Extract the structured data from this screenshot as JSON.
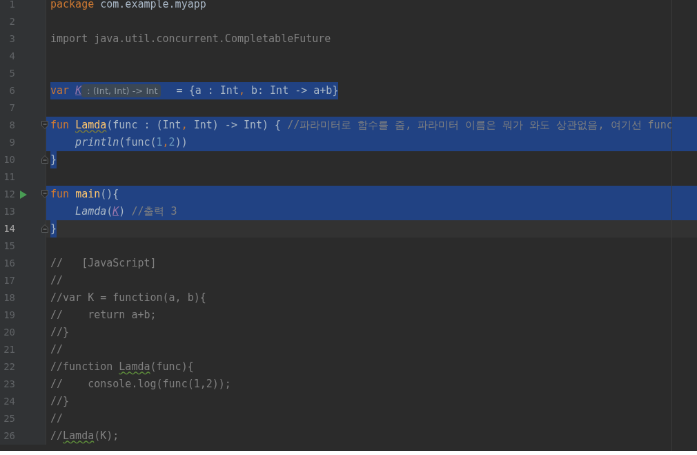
{
  "lines": [
    {
      "number": "1",
      "selected": false,
      "current": false,
      "run": false,
      "fold_start": false,
      "fold_end": false,
      "tokens": [
        {
          "text": "package ",
          "kind": "keyword"
        },
        {
          "text": "com.example.myapp",
          "kind": "plain"
        }
      ]
    },
    {
      "number": "2",
      "selected": false,
      "current": false,
      "run": false,
      "fold_start": false,
      "fold_end": false
    },
    {
      "number": "3",
      "selected": false,
      "current": false,
      "run": false,
      "fold_start": false,
      "fold_end": false,
      "tokens": [
        {
          "text": "import java.util.concurrent.CompletableFuture",
          "kind": "unused"
        }
      ]
    },
    {
      "number": "4",
      "selected": false,
      "current": false,
      "run": false,
      "fold_start": false,
      "fold_end": false
    },
    {
      "number": "5",
      "selected": false,
      "current": false,
      "run": false,
      "fold_start": false,
      "fold_end": false
    },
    {
      "number": "6",
      "selected": true,
      "current": false,
      "run": false,
      "fold_start": false,
      "fold_end": false,
      "tokens": [
        {
          "text": "var ",
          "kind": "keyword"
        },
        {
          "text": "K",
          "kind": "ref"
        },
        {
          "text": " : (Int, Int) -> Int",
          "kind": "hint"
        },
        {
          "text": " = {a : Int",
          "kind": "plain"
        },
        {
          "text": ",",
          "kind": "keyword"
        },
        {
          "text": " b: Int -> a+b}",
          "kind": "plain"
        }
      ]
    },
    {
      "number": "7",
      "selected": false,
      "current": false,
      "run": false,
      "fold_start": false,
      "fold_end": false
    },
    {
      "number": "8",
      "selected": true,
      "current": false,
      "run": false,
      "fold_start": true,
      "fold_end": false,
      "tokens": [
        {
          "text": "fun ",
          "kind": "keyword"
        },
        {
          "text": "Lamda",
          "kind": "decl"
        },
        {
          "text": "(func : (Int",
          "kind": "plain"
        },
        {
          "text": ",",
          "kind": "keyword"
        },
        {
          "text": " Int) -> Int) { ",
          "kind": "plain"
        },
        {
          "text": "//파라미터로 함수를 줌, 파라미터 이름은 뭐가 와도 상관없음, 여기선 func",
          "kind": "comment"
        }
      ]
    },
    {
      "number": "9",
      "selected": true,
      "current": false,
      "run": false,
      "fold_start": false,
      "fold_end": false,
      "tokens": [
        {
          "text": "    println",
          "kind": "call"
        },
        {
          "text": "(func(",
          "kind": "plain"
        },
        {
          "text": "1",
          "kind": "number"
        },
        {
          "text": ",",
          "kind": "keyword"
        },
        {
          "text": "2",
          "kind": "number"
        },
        {
          "text": "))",
          "kind": "plain"
        }
      ]
    },
    {
      "number": "10",
      "selected": true,
      "current": false,
      "run": false,
      "fold_start": false,
      "fold_end": true,
      "tokens": [
        {
          "text": "}",
          "kind": "plain"
        }
      ]
    },
    {
      "number": "11",
      "selected": false,
      "current": false,
      "run": false,
      "fold_start": false,
      "fold_end": false
    },
    {
      "number": "12",
      "selected": true,
      "current": false,
      "run": true,
      "fold_start": true,
      "fold_end": false,
      "tokens": [
        {
          "text": "fun ",
          "kind": "keyword"
        },
        {
          "text": "main",
          "kind": "decl"
        },
        {
          "text": "(){",
          "kind": "plain"
        }
      ]
    },
    {
      "number": "13",
      "selected": true,
      "current": false,
      "run": false,
      "fold_start": false,
      "fold_end": false,
      "tokens": [
        {
          "text": "    Lamda",
          "kind": "call"
        },
        {
          "text": "(",
          "kind": "plain"
        },
        {
          "text": "K",
          "kind": "ref"
        },
        {
          "text": ") ",
          "kind": "plain"
        },
        {
          "text": "//출력 3",
          "kind": "comment"
        }
      ]
    },
    {
      "number": "14",
      "selected": true,
      "current": true,
      "run": false,
      "fold_start": false,
      "fold_end": true,
      "tokens": [
        {
          "text": "}",
          "kind": "plain"
        }
      ]
    },
    {
      "number": "15",
      "selected": false,
      "current": false,
      "run": false,
      "fold_start": false,
      "fold_end": false
    },
    {
      "number": "16",
      "selected": false,
      "current": false,
      "run": false,
      "fold_start": false,
      "fold_end": false,
      "tokens": [
        {
          "text": "//   [JavaScript]",
          "kind": "comment"
        }
      ]
    },
    {
      "number": "17",
      "selected": false,
      "current": false,
      "run": false,
      "fold_start": false,
      "fold_end": false,
      "tokens": [
        {
          "text": "//",
          "kind": "comment"
        }
      ]
    },
    {
      "number": "18",
      "selected": false,
      "current": false,
      "run": false,
      "fold_start": false,
      "fold_end": false,
      "tokens": [
        {
          "text": "//var K = function(a, b){",
          "kind": "comment"
        }
      ]
    },
    {
      "number": "19",
      "selected": false,
      "current": false,
      "run": false,
      "fold_start": false,
      "fold_end": false,
      "tokens": [
        {
          "text": "//    return a+b;",
          "kind": "comment"
        }
      ]
    },
    {
      "number": "20",
      "selected": false,
      "current": false,
      "run": false,
      "fold_start": false,
      "fold_end": false,
      "tokens": [
        {
          "text": "//}",
          "kind": "comment"
        }
      ]
    },
    {
      "number": "21",
      "selected": false,
      "current": false,
      "run": false,
      "fold_start": false,
      "fold_end": false,
      "tokens": [
        {
          "text": "//",
          "kind": "comment"
        }
      ]
    },
    {
      "number": "22",
      "selected": false,
      "current": false,
      "run": false,
      "fold_start": false,
      "fold_end": false,
      "tokens": [
        {
          "text": "//function ",
          "kind": "comment"
        },
        {
          "text": "Lamda",
          "kind": "typo"
        },
        {
          "text": "(func){",
          "kind": "comment"
        }
      ]
    },
    {
      "number": "23",
      "selected": false,
      "current": false,
      "run": false,
      "fold_start": false,
      "fold_end": false,
      "tokens": [
        {
          "text": "//    console.log(func(1,2));",
          "kind": "comment"
        }
      ]
    },
    {
      "number": "24",
      "selected": false,
      "current": false,
      "run": false,
      "fold_start": false,
      "fold_end": false,
      "tokens": [
        {
          "text": "//}",
          "kind": "comment"
        }
      ]
    },
    {
      "number": "25",
      "selected": false,
      "current": false,
      "run": false,
      "fold_start": false,
      "fold_end": false,
      "tokens": [
        {
          "text": "//",
          "kind": "comment"
        }
      ]
    },
    {
      "number": "26",
      "selected": false,
      "current": false,
      "run": false,
      "fold_start": false,
      "fold_end": false,
      "tokens": [
        {
          "text": "//",
          "kind": "comment"
        },
        {
          "text": "Lamda",
          "kind": "typo"
        },
        {
          "text": "(K);",
          "kind": "comment"
        }
      ]
    }
  ]
}
